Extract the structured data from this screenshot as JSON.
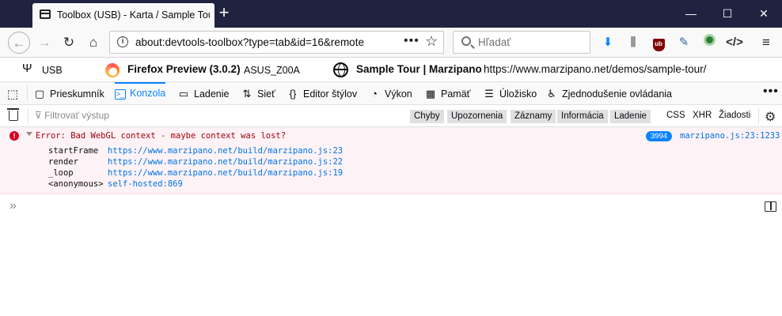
{
  "browser": {
    "tab_title": "Toolbox (USB) - Karta / Sample Tour",
    "new_tab_symbol": "+",
    "window_controls": {
      "minimize": "—",
      "maximize": "☐",
      "close": "✕"
    }
  },
  "navbar": {
    "url": "about:devtools-toolbox?type=tab&id=16&remote",
    "page_actions": "•••",
    "bookmark_star": "☆",
    "search_placeholder": "Hľadať",
    "icons": [
      "download-icon",
      "library-icon",
      "ublock-icon",
      "screenshot-icon",
      "sync-icon",
      "devtools-icon",
      "menu-icon"
    ]
  },
  "target": {
    "connection": "USB",
    "browser_name": "Firefox Preview (3.0.2)",
    "device": "ASUS_Z00A",
    "page_title": "Sample Tour | Marzipano",
    "page_url": "https://www.marzipano.net/demos/sample-tour/"
  },
  "tools": [
    {
      "label": "Prieskumník",
      "icon": "inspector-icon"
    },
    {
      "label": "Konzola",
      "icon": "console-icon",
      "active": true
    },
    {
      "label": "Ladenie",
      "icon": "debugger-icon"
    },
    {
      "label": "Sieť",
      "icon": "network-icon"
    },
    {
      "label": "Editor štýlov",
      "icon": "style-editor-icon"
    },
    {
      "label": "Výkon",
      "icon": "performance-icon"
    },
    {
      "label": "Pamäť",
      "icon": "memory-icon"
    },
    {
      "label": "Úložisko",
      "icon": "storage-icon"
    },
    {
      "label": "Zjednodušenie ovládania",
      "icon": "accessibility-icon"
    }
  ],
  "console_filter": {
    "placeholder": "Filtrovať výstup",
    "levels": [
      "Chyby",
      "Upozornenia",
      "Záznamy",
      "Informácia",
      "Ladenie"
    ],
    "extra": [
      "CSS",
      "XHR",
      "Žiadosti"
    ]
  },
  "message": {
    "text": "Error: Bad WebGL context - maybe context was lost?",
    "repeat_count": "3994",
    "location": "marzipano.js:23:1233",
    "stack": [
      {
        "fn": "startFrame",
        "loc": "https://www.marzipano.net/build/marzipano.js:23"
      },
      {
        "fn": "render",
        "loc": "https://www.marzipano.net/build/marzipano.js:22"
      },
      {
        "fn": "_loop",
        "loc": "https://www.marzipano.net/build/marzipano.js:19"
      },
      {
        "fn": "<anonymous>",
        "loc": "self-hosted:869"
      }
    ]
  },
  "input": {
    "prompt": "»"
  }
}
